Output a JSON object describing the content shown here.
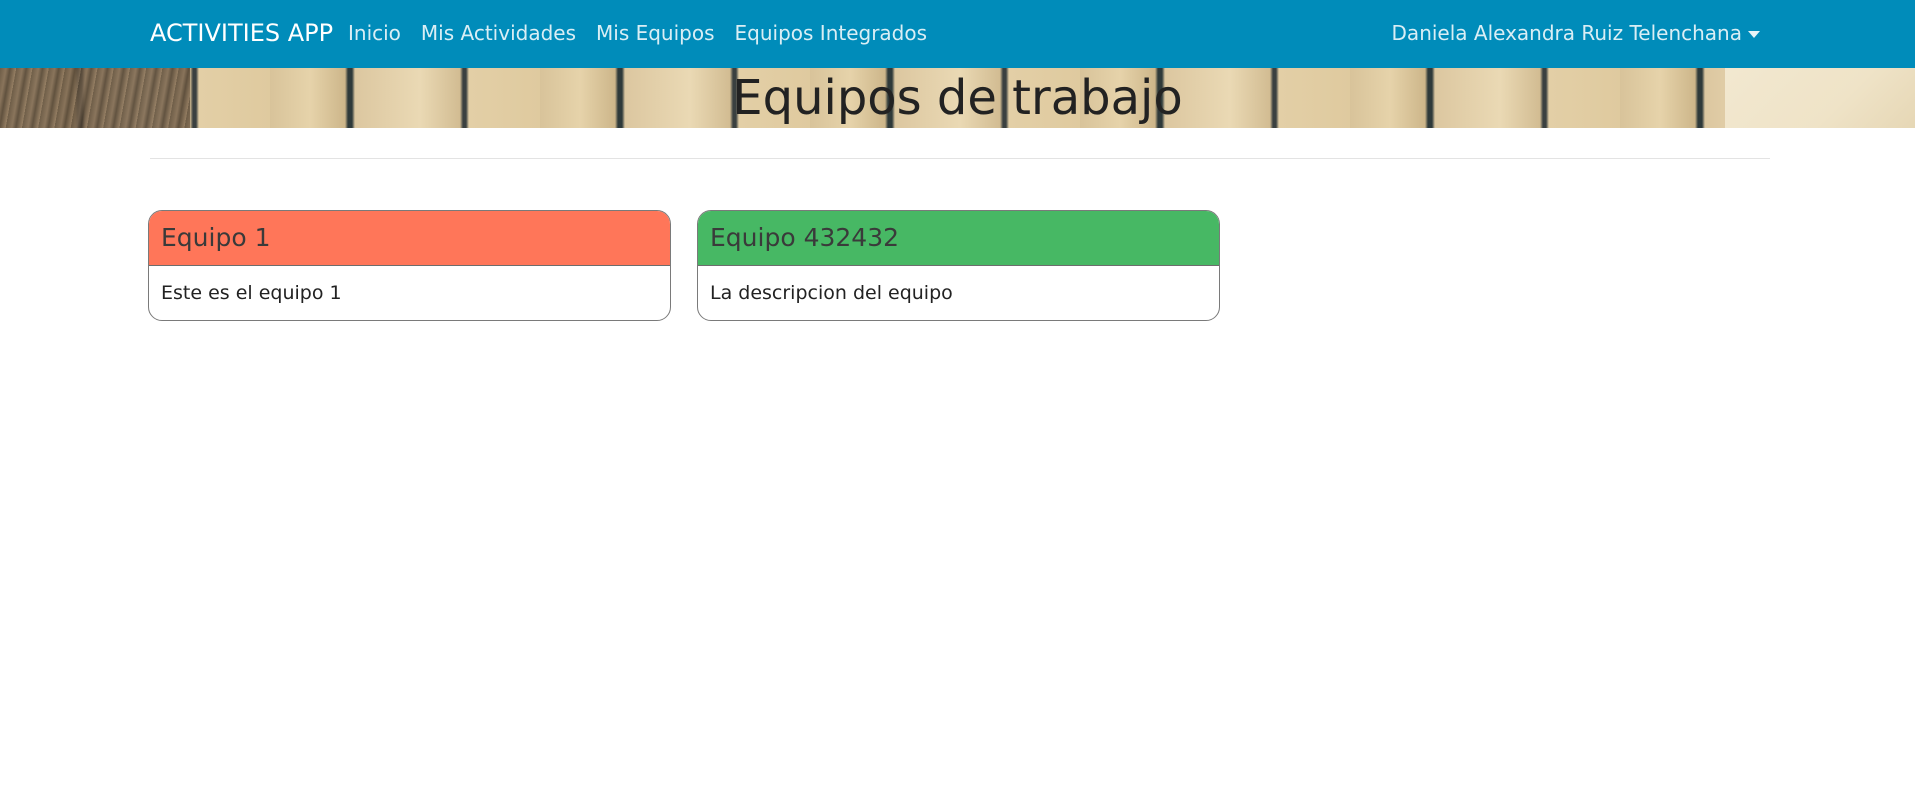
{
  "navbar": {
    "brand": "ACTIVITIES APP",
    "links": [
      {
        "label": "Inicio"
      },
      {
        "label": "Mis Actividades"
      },
      {
        "label": "Mis Equipos"
      },
      {
        "label": "Equipos Integrados"
      }
    ],
    "user": "Daniela Alexandra Ruiz Telenchana",
    "user_icon": "chevron-down-icon",
    "background": "#008cba"
  },
  "banner": {
    "title": "Equipos de trabajo"
  },
  "teams": [
    {
      "title": "Equipo 1",
      "description": "Este es el equipo 1",
      "color": "#ff7659"
    },
    {
      "title": "Equipo 432432",
      "description": "La descripcion del equipo",
      "color": "#47b864"
    }
  ]
}
